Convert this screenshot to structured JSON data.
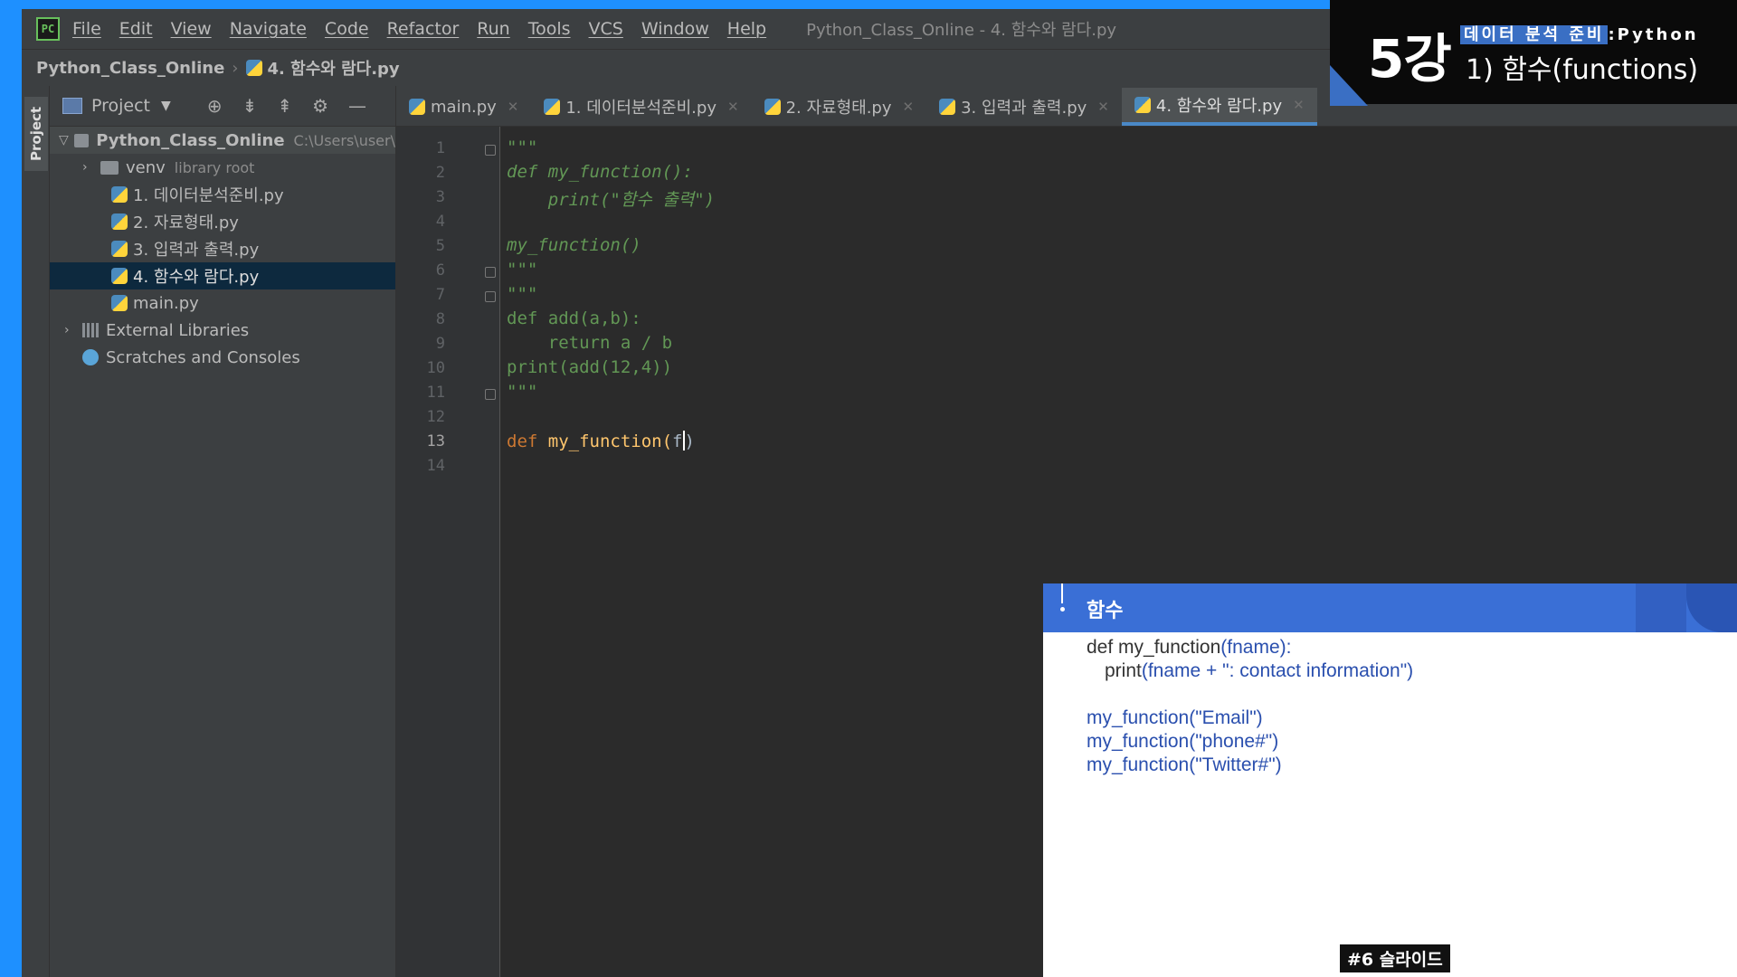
{
  "menu": {
    "items": [
      "File",
      "Edit",
      "View",
      "Navigate",
      "Code",
      "Refactor",
      "Run",
      "Tools",
      "VCS",
      "Window",
      "Help"
    ],
    "window_title": "Python_Class_Online - 4. 함수와 람다.py"
  },
  "breadcrumb": {
    "root": "Python_Class_Online",
    "file": "4. 함수와 람다.py"
  },
  "sidebar": {
    "strip_label": "Project"
  },
  "project": {
    "title": "Project",
    "tree": {
      "root_name": "Python_Class_Online",
      "root_path": "C:\\Users\\user\\",
      "venv": "venv",
      "venv_note": "library root",
      "files": [
        "1. 데이터분석준비.py",
        "2. 자료형태.py",
        "3. 입력과 출력.py",
        "4. 함수와 람다.py",
        "main.py"
      ],
      "external": "External Libraries",
      "scratches": "Scratches and Consoles"
    }
  },
  "tabs": [
    "main.py",
    "1. 데이터분석준비.py",
    "2. 자료형태.py",
    "3. 입력과 출력.py",
    "4. 함수와 람다.py"
  ],
  "editor": {
    "line_numbers": [
      "1",
      "2",
      "3",
      "4",
      "5",
      "6",
      "7",
      "8",
      "9",
      "10",
      "11",
      "12",
      "13",
      "14"
    ],
    "lines": {
      "l1": "\"\"\"",
      "l2_kw": "def ",
      "l2_fn": "my_function():",
      "l3": "    print(\"함수 출력\")",
      "l5": "my_function()",
      "l6": "\"\"\"",
      "l7": "\"\"\"",
      "l8": "def add(a,b):",
      "l9": "    return a / b",
      "l10": "print(add(12,4))",
      "l11": "\"\"\"",
      "l13_kw": "def ",
      "l13_fn": "my_function(",
      "l13_arg": "f",
      "l13_end": ")"
    }
  },
  "lecture": {
    "number": "5강",
    "tag": "데이터 분석 준비",
    "tag_suffix": ":Python",
    "subtitle": "1) 함수(functions)"
  },
  "slide": {
    "title": "함수",
    "code": {
      "line1_a": "def my_function",
      "line1_b": "(fname):",
      "line2_a": "print",
      "line2_b": "(fname + \": contact information\")",
      "call1_a": "my_function",
      "call1_b": "(\"Email\")",
      "call2_a": "my_function",
      "call2_b": "(\"phone#\")",
      "call3_a": "my_function",
      "call3_b": "(\"Twitter#\")"
    },
    "badge": "#6 슬라이드"
  },
  "colors": {
    "frame_blue": "#1e90ff",
    "tab_active_underline": "#4a88c7",
    "slide_header": "#3a6fd6"
  }
}
